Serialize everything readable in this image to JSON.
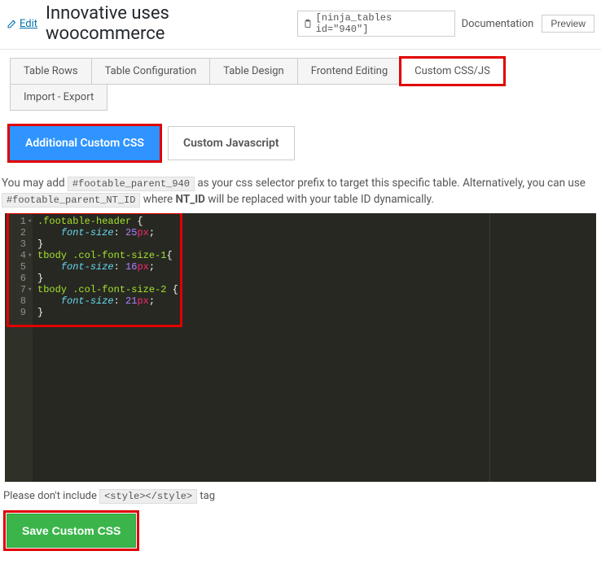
{
  "header": {
    "edit_label": "Edit",
    "title": "Innovative uses woocommerce",
    "shortcode": "[ninja_tables id=\"940\"]",
    "documentation_label": "Documentation",
    "preview_label": "Preview"
  },
  "tabs": [
    {
      "label": "Table Rows",
      "active": false
    },
    {
      "label": "Table Configuration",
      "active": false
    },
    {
      "label": "Table Design",
      "active": false
    },
    {
      "label": "Frontend Editing",
      "active": false
    },
    {
      "label": "Custom CSS/JS",
      "active": true,
      "highlighted": true
    },
    {
      "label": "Import - Export",
      "active": false
    }
  ],
  "subtabs": [
    {
      "label": "Additional Custom CSS",
      "primary": true,
      "highlighted": true
    },
    {
      "label": "Custom Javascript",
      "primary": false
    }
  ],
  "help": {
    "prefix": "You may add",
    "selector1": "#footable_parent_940",
    "mid": "as your css selector prefix to target this specific table. Alternatively, you can use",
    "selector2": "#footable_parent_NT_ID",
    "suffix_before_bold": "where",
    "bold": "NT_ID",
    "suffix_after_bold": "will be replaced with your table ID dynamically."
  },
  "code": [
    {
      "indent": 0,
      "selector": ".footable-header",
      "brace": " {",
      "fold": true
    },
    {
      "indent": 1,
      "prop": "font-size",
      "colon": ": ",
      "num": "25",
      "unit": "px",
      "semi": ";"
    },
    {
      "indent": 0,
      "brace_close": "}"
    },
    {
      "indent": 0,
      "selector": "tbody .col-font-size-1",
      "brace": "{",
      "fold": true
    },
    {
      "indent": 1,
      "prop": "font-size",
      "colon": ": ",
      "num": "16",
      "unit": "px",
      "semi": ";"
    },
    {
      "indent": 0,
      "brace_close": "}"
    },
    {
      "indent": 0,
      "selector": "tbody .col-font-size-2",
      "brace": " {",
      "fold": true
    },
    {
      "indent": 1,
      "prop": "font-size",
      "colon": ": ",
      "num": "21",
      "unit": "px",
      "semi": ";"
    },
    {
      "indent": 0,
      "brace_close": "}"
    }
  ],
  "note": {
    "before": "Please don't include",
    "code": "<style></style>",
    "after": "tag"
  },
  "save_label": "Save Custom CSS"
}
